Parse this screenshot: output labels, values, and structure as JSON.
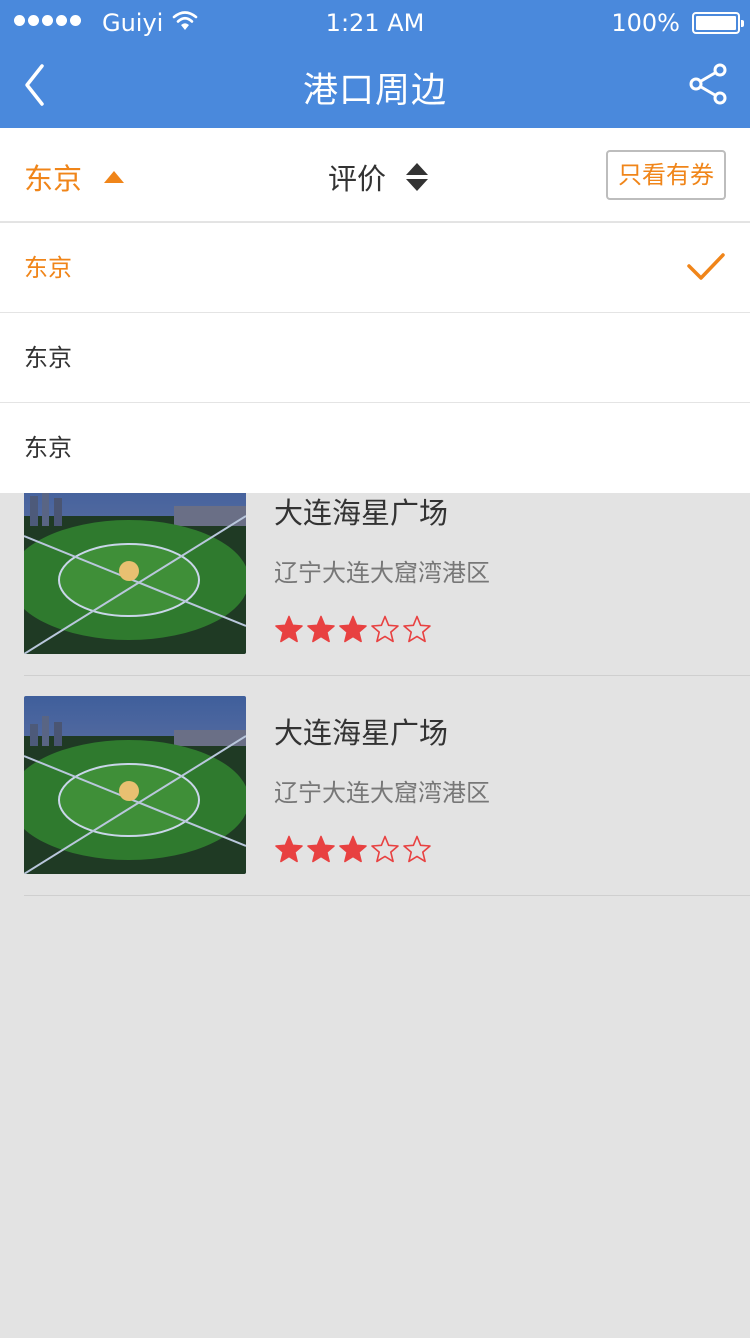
{
  "status_bar": {
    "carrier": "Guiyi",
    "time": "1:21 AM",
    "battery": "100%"
  },
  "nav": {
    "title": "港口周边",
    "back_icon": "chevron-left-icon",
    "share_icon": "share-icon"
  },
  "filter": {
    "city_label": "东京",
    "sort_label": "评价",
    "coupon_label": "只看有券"
  },
  "dropdown": {
    "options": [
      {
        "label": "东京",
        "selected": true
      },
      {
        "label": "东京",
        "selected": false
      },
      {
        "label": "东京",
        "selected": false
      }
    ]
  },
  "list": {
    "items": [
      {
        "title": "大连海星广场",
        "address": "辽宁大连大窟湾港区",
        "rating": 3,
        "max_rating": 5
      },
      {
        "title": "大连海星广场",
        "address": "辽宁大连大窟湾港区",
        "rating": 3,
        "max_rating": 5
      }
    ]
  },
  "colors": {
    "nav_bg": "#4a89dc",
    "accent": "#f08519",
    "star": "#e84141"
  }
}
